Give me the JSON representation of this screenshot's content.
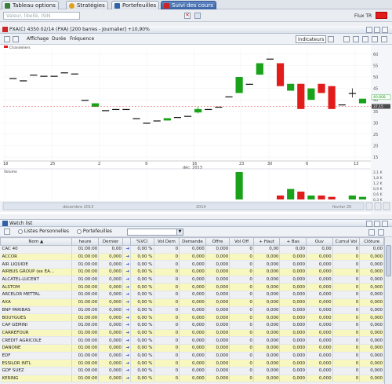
{
  "tabs": [
    {
      "label": "Tableau options",
      "icon_color": "#3c7f3c"
    },
    {
      "label": "Stratégies",
      "icon_color": "#e0a020"
    },
    {
      "label": "Portefeuilles",
      "icon_color": "#2f62a8"
    },
    {
      "label": "Suivi des cours",
      "icon_color": "#cf2424"
    }
  ],
  "search": {
    "placeholder": "Valeur, libellé, ISIN"
  },
  "flux": {
    "label": "Flux TR",
    "color": "#e21b1b"
  },
  "chart_header": {
    "title": "PXA(C) 4350 02/14 (PXA)  [200 barres - Journalier]  +10,90%"
  },
  "chart_toolbar": {
    "items": [
      "Affichage",
      "Durée",
      "Fréquence"
    ],
    "indicators": "indicateurs"
  },
  "chart_data": {
    "type": "candlestick",
    "legend": "Chandeliers",
    "x_ticks": [
      "18",
      "25",
      "2",
      "9",
      "16",
      "23",
      "30",
      "6",
      "13"
    ],
    "month_label": "déc. 2013",
    "y_ticks": [
      "60",
      "55",
      "50",
      "45",
      "40",
      "35",
      "30",
      "25",
      "20",
      "15"
    ],
    "last_labels": [
      "40,808",
      "37,15"
    ],
    "volume_label": "Volume",
    "volume_ticks": [
      "2,1 K",
      "1,8 K",
      "1,2 K",
      "0,9 K",
      "0,6 K",
      "0,3 K"
    ],
    "navigator": {
      "left": "décembre 2013",
      "mid": "2014",
      "right": "février 20"
    },
    "candles": [
      {
        "o": 49.5,
        "c": 49.5,
        "h": 49.5,
        "l": 49.5
      },
      {
        "o": 48.5,
        "c": 48.5,
        "h": 48.5,
        "l": 48.5
      },
      {
        "o": 51,
        "c": 51,
        "h": 51,
        "l": 51
      },
      {
        "o": 50.5,
        "c": 50.5,
        "h": 50.5,
        "l": 50.5
      },
      {
        "o": 50.5,
        "c": 50.5,
        "h": 50.5,
        "l": 50.5
      },
      {
        "o": 52,
        "c": 52,
        "h": 52,
        "l": 52
      },
      {
        "o": 51.5,
        "c": 51.5,
        "h": 51.5,
        "l": 51.5
      },
      {
        "o": 40,
        "c": 40,
        "h": 40,
        "l": 40
      },
      {
        "o": 37,
        "c": 38.5,
        "h": 38.5,
        "l": 37
      },
      {
        "o": 35.5,
        "c": 35.5,
        "h": 35.5,
        "l": 35.5
      },
      {
        "o": 36,
        "c": 36,
        "h": 36,
        "l": 36
      },
      {
        "o": 36,
        "c": 36,
        "h": 36,
        "l": 36
      },
      {
        "o": 32,
        "c": 32,
        "h": 32,
        "l": 32
      },
      {
        "o": 30,
        "c": 30,
        "h": 30,
        "l": 30
      },
      {
        "o": 31,
        "c": 31,
        "h": 31,
        "l": 31
      },
      {
        "o": 31,
        "c": 32,
        "h": 32,
        "l": 31
      },
      {
        "o": 32.5,
        "c": 32.5,
        "h": 32.5,
        "l": 32.5
      },
      {
        "o": 33,
        "c": 33,
        "h": 33,
        "l": 33
      },
      {
        "o": 34.5,
        "c": 36,
        "h": 37,
        "l": 34
      },
      {
        "o": 36,
        "c": 36,
        "h": 36,
        "l": 36
      },
      {
        "o": 37,
        "c": 37,
        "h": 37,
        "l": 37
      },
      {
        "o": 41.5,
        "c": 41.5,
        "h": 41.5,
        "l": 41.5
      },
      {
        "o": 43,
        "c": 50,
        "h": 50,
        "l": 43
      },
      {
        "o": 47,
        "c": 47,
        "h": 47,
        "l": 47
      },
      {
        "o": 51,
        "c": 56,
        "h": 56,
        "l": 51
      },
      {
        "o": 58,
        "c": 58,
        "h": 58,
        "l": 58
      },
      {
        "o": 56,
        "c": 46,
        "h": 56,
        "l": 46
      },
      {
        "o": 44,
        "c": 47,
        "h": 47,
        "l": 44
      },
      {
        "o": 47,
        "c": 36,
        "h": 47,
        "l": 36
      },
      {
        "o": 40,
        "c": 45,
        "h": 45,
        "l": 40
      },
      {
        "o": 47,
        "c": 43,
        "h": 47,
        "l": 43
      },
      {
        "o": 46,
        "c": 36,
        "h": 46,
        "l": 36
      },
      {
        "o": 38,
        "c": 38,
        "h": 38,
        "l": 38
      },
      {
        "o": 43,
        "c": 43,
        "h": 45,
        "l": 41
      },
      {
        "o": 38.5,
        "c": 40.5,
        "h": 40.5,
        "l": 38.5
      }
    ],
    "volumes": [
      0,
      0,
      0,
      0,
      0,
      0,
      0,
      0,
      0,
      0,
      0,
      0,
      0,
      0,
      0,
      0,
      0,
      0,
      0,
      0,
      0,
      0,
      2.1,
      0,
      0,
      0,
      0.3,
      0.8,
      0.6,
      0.3,
      0.3,
      0.2,
      0,
      0.3,
      0.2
    ],
    "xlabel": "",
    "ylabel": ""
  },
  "watchlist": {
    "title": "Watch list",
    "radio1": "Listes Personnelles",
    "radio2": "Portefeuilles",
    "columns": [
      "Nom ▲",
      "heure",
      "Dernier",
      "",
      "%VCl",
      "Vol Dem",
      "Demande",
      "Offre",
      "Vol Off",
      "+ Haut",
      "+ Bas",
      "Ouv",
      "Cumul Vol",
      "Clôture"
    ],
    "rows": [
      [
        "CAC 40",
        "01:00:00",
        "0,00",
        "0,00 %",
        "0",
        "0,000",
        "0,000",
        "0",
        "0,00",
        "0,00",
        "0,00",
        "0",
        "0,00"
      ],
      [
        "ACCOR",
        "01:00:00",
        "0,000",
        "0,00 %",
        "0",
        "0,000",
        "0,000",
        "0",
        "0,000",
        "0,000",
        "0,000",
        "0",
        "0,000"
      ],
      [
        "AIR LIQUIDE",
        "01:00:00",
        "0,000",
        "0,00 %",
        "0",
        "0,000",
        "0,000",
        "0",
        "0,000",
        "0,000",
        "0,000",
        "0",
        "0,000"
      ],
      [
        "AIRBUS GROUP (ex EA...",
        "01:00:00",
        "0,000",
        "0,00 %",
        "0",
        "0,000",
        "0,000",
        "0",
        "0,000",
        "0,000",
        "0,000",
        "0",
        "0,000"
      ],
      [
        "ALCATEL-LUCENT",
        "01:00:00",
        "0,000",
        "0,00 %",
        "0",
        "0,000",
        "0,000",
        "0",
        "0,000",
        "0,000",
        "0,000",
        "0",
        "0,000"
      ],
      [
        "ALSTOM",
        "01:00:00",
        "0,000",
        "0,00 %",
        "0",
        "0,000",
        "0,000",
        "0",
        "0,000",
        "0,000",
        "0,000",
        "0",
        "0,000"
      ],
      [
        "ARCELOR METTAL",
        "01:00:00",
        "0,000",
        "0,00 %",
        "0",
        "0,000",
        "0,000",
        "0",
        "0,000",
        "0,000",
        "0,000",
        "0",
        "0,000"
      ],
      [
        "AXA",
        "01:00:00",
        "0,000",
        "0,00 %",
        "0",
        "0,000",
        "0,000",
        "0",
        "0,000",
        "0,000",
        "0,000",
        "0",
        "0,000"
      ],
      [
        "BNP PARIBAS",
        "01:00:00",
        "0,000",
        "0,00 %",
        "0",
        "0,000",
        "0,000",
        "0",
        "0,000",
        "0,000",
        "0,000",
        "0",
        "0,000"
      ],
      [
        "BOUYGUES",
        "01:00:00",
        "0,000",
        "0,00 %",
        "0",
        "0,000",
        "0,000",
        "0",
        "0,000",
        "0,000",
        "0,000",
        "0",
        "0,000"
      ],
      [
        "CAP GEMINI",
        "01:00:00",
        "0,000",
        "0,00 %",
        "0",
        "0,000",
        "0,000",
        "0",
        "0,000",
        "0,000",
        "0,000",
        "0",
        "0,000"
      ],
      [
        "CARREFOUR",
        "01:00:00",
        "0,000",
        "0,00 %",
        "0",
        "0,000",
        "0,000",
        "0",
        "0,000",
        "0,000",
        "0,000",
        "0",
        "0,000"
      ],
      [
        "CREDIT AGRICOLE",
        "01:00:00",
        "0,000",
        "0,00 %",
        "0",
        "0,000",
        "0,000",
        "0",
        "0,000",
        "0,000",
        "0,000",
        "0",
        "0,000"
      ],
      [
        "DANONE",
        "01:00:00",
        "0,000",
        "0,00 %",
        "0",
        "0,000",
        "0,000",
        "0",
        "0,000",
        "0,000",
        "0,000",
        "0",
        "0,000"
      ],
      [
        "EDF",
        "01:00:00",
        "0,000",
        "0,00 %",
        "0",
        "0,000",
        "0,000",
        "0",
        "0,000",
        "0,000",
        "0,000",
        "0",
        "0,000"
      ],
      [
        "ESSILOR INTL",
        "01:00:00",
        "0,000",
        "0,00 %",
        "0",
        "0,000",
        "0,000",
        "0",
        "0,000",
        "0,000",
        "0,000",
        "0",
        "0,000"
      ],
      [
        "GDF SUEZ",
        "01:00:00",
        "0,000",
        "0,00 %",
        "0",
        "0,000",
        "0,000",
        "0",
        "0,000",
        "0,000",
        "0,000",
        "0",
        "0,000"
      ],
      [
        "KERING",
        "01:00:00",
        "0,000",
        "0,00 %",
        "0",
        "0,000",
        "0,000",
        "0",
        "0,000",
        "0,000",
        "0,000",
        "0",
        "0,000"
      ]
    ]
  }
}
